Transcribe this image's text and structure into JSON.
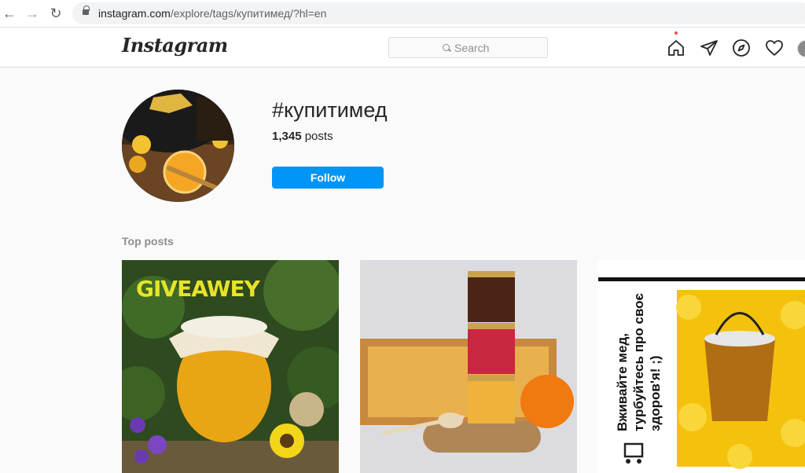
{
  "browser": {
    "url_host": "instagram.com",
    "url_path": "/explore/tags/купитимед/?hl=en"
  },
  "header": {
    "logo": "Instagram",
    "search_placeholder": "Search",
    "icons": [
      "home-icon",
      "direct-icon",
      "explore-icon",
      "heart-icon",
      "profile-avatar"
    ]
  },
  "tag": {
    "title": "#купитимед",
    "post_count": "1,345",
    "post_label": " posts",
    "follow_label": "Follow"
  },
  "sections": {
    "top_posts": "Top posts"
  },
  "posts": [
    {
      "caption": "GIVEAWEY"
    },
    {
      "caption": ""
    },
    {
      "caption": "Вживайте мед, турбуйтесь про своє здоров'я! ;)"
    }
  ],
  "colors": {
    "accent": "#0095f6",
    "notification": "#ed4956",
    "giveaway_text": "#e8e32a"
  }
}
